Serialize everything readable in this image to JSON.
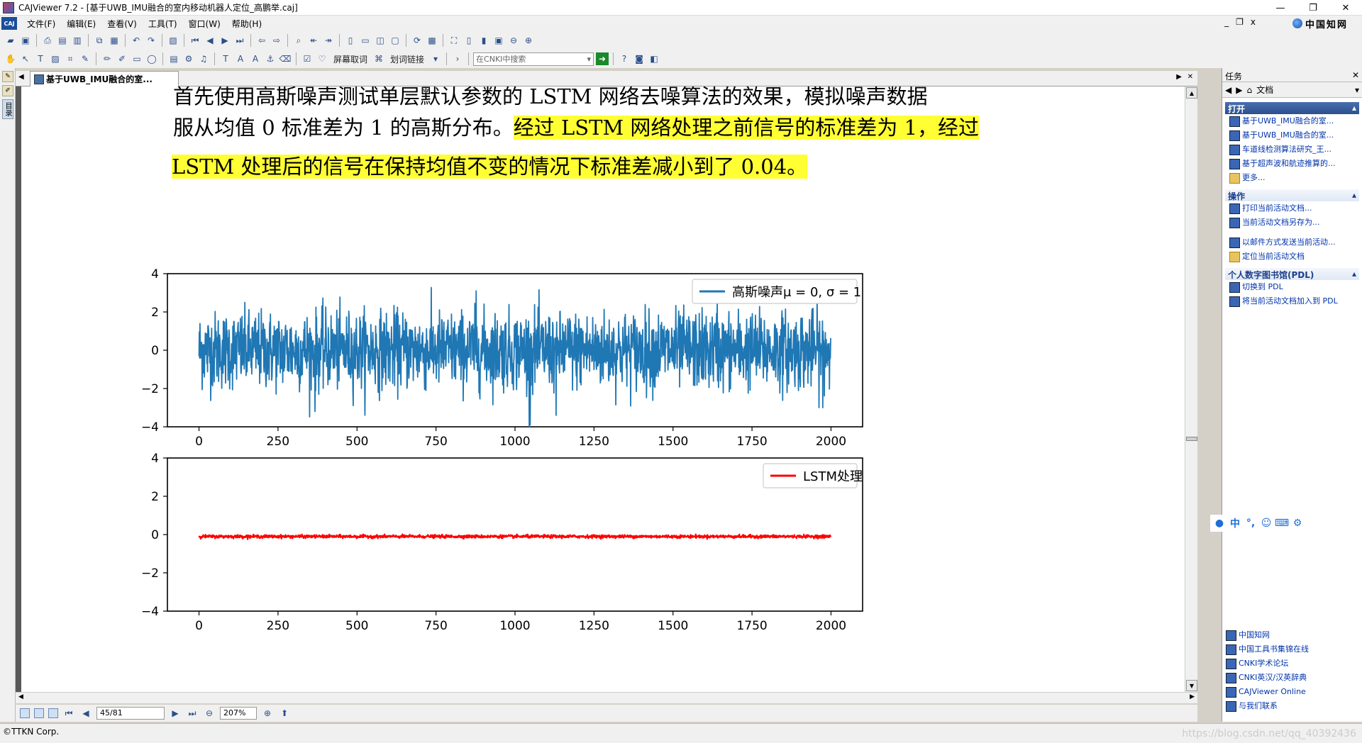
{
  "window": {
    "title": "CAJViewer 7.2 - [基于UWB_IMU融合的室内移动机器人定位_高鹏举.caj]",
    "controls": [
      "—",
      "❐",
      "✕"
    ]
  },
  "menubar": {
    "items": [
      "文件(F)",
      "编辑(E)",
      "查看(V)",
      "工具(T)",
      "窗口(W)",
      "帮助(H)"
    ],
    "right_controls": [
      "_",
      "❐",
      "x"
    ],
    "cnki_brand": "中国知网"
  },
  "toolbar2": {
    "screen_fetch": "屏幕取词",
    "word_link": "划词链接",
    "search_placeholder": "在CNKI中搜索"
  },
  "leftstrip": {
    "toc_label": "目录"
  },
  "tab": {
    "label": "基于UWB_IMU融合的室..."
  },
  "document": {
    "line1": "首先使用高斯噪声测试单层默认参数的 LSTM 网络去噪算法的效果，模拟噪声数据",
    "line2_plain": "服从均值 0 标准差为 1 的高斯分布。",
    "line2_highlight": "经过 LSTM 网络处理之前信号的标准差为 1，经过",
    "line3_highlight": "LSTM 处理后的信号在保持均值不变的情况下标准差减小到了 0.04。"
  },
  "chart_data": [
    {
      "type": "line",
      "legend": "高斯噪声μ = 0, σ = 1",
      "legend_position": "top-right",
      "color": "#1f77b4",
      "xlim": [
        -100,
        2100
      ],
      "ylim": [
        -4,
        4
      ],
      "xticks": [
        0,
        250,
        500,
        750,
        1000,
        1250,
        1500,
        1750,
        2000
      ],
      "yticks": [
        4,
        2,
        0,
        -2,
        -4
      ],
      "n_points": 2000,
      "mean": 0,
      "std": 1,
      "notable_extremes": [
        [
          367,
          -3.2
        ],
        [
          1048,
          -3.9
        ],
        [
          1130,
          -3.4
        ],
        [
          877,
          3.1
        ],
        [
          1640,
          3.0
        ],
        [
          1974,
          -3.0
        ]
      ]
    },
    {
      "type": "line",
      "legend": "LSTM处理",
      "legend_position": "top-right",
      "color": "#ff0000",
      "xlim": [
        -100,
        2100
      ],
      "ylim": [
        -4,
        4
      ],
      "xticks": [
        0,
        250,
        500,
        750,
        1000,
        1250,
        1500,
        1750,
        2000
      ],
      "yticks": [
        4,
        2,
        0,
        -2,
        -4
      ],
      "n_points": 2000,
      "mean": -0.1,
      "std": 0.04
    }
  ],
  "statusbar": {
    "page": "45/81",
    "zoom": "207%"
  },
  "footer": {
    "copyright": "©TTKN Corp.",
    "watermark": "https://blog.csdn.net/qq_40392436"
  },
  "rightpane": {
    "header": "任务",
    "nav_label": "文档",
    "open": {
      "title": "打开",
      "items": [
        "基于UWB_IMU融合的室...",
        "基于UWB_IMU融合的室...",
        "车道线检测算法研究_王...",
        "基于超声波和航迹推算的...",
        "更多..."
      ]
    },
    "ops": {
      "title": "操作",
      "items": [
        "打印当前活动文档...",
        "当前活动文档另存为...",
        "以邮件方式发送当前活动...",
        "定位当前活动文档"
      ]
    },
    "pdl": {
      "title": "个人数字图书馆(PDL)",
      "items": [
        "切换到 PDL",
        "将当前活动文档加入到 PDL"
      ]
    },
    "links": [
      "中国知网",
      "中国工具书集锦在线",
      "CNKI学术论坛",
      "CNKI英汉/汉英辞典",
      "CAJViewer Online",
      "与我们联系"
    ]
  },
  "ime": [
    "中",
    "°,",
    "☺",
    "⌨",
    "⚙"
  ]
}
